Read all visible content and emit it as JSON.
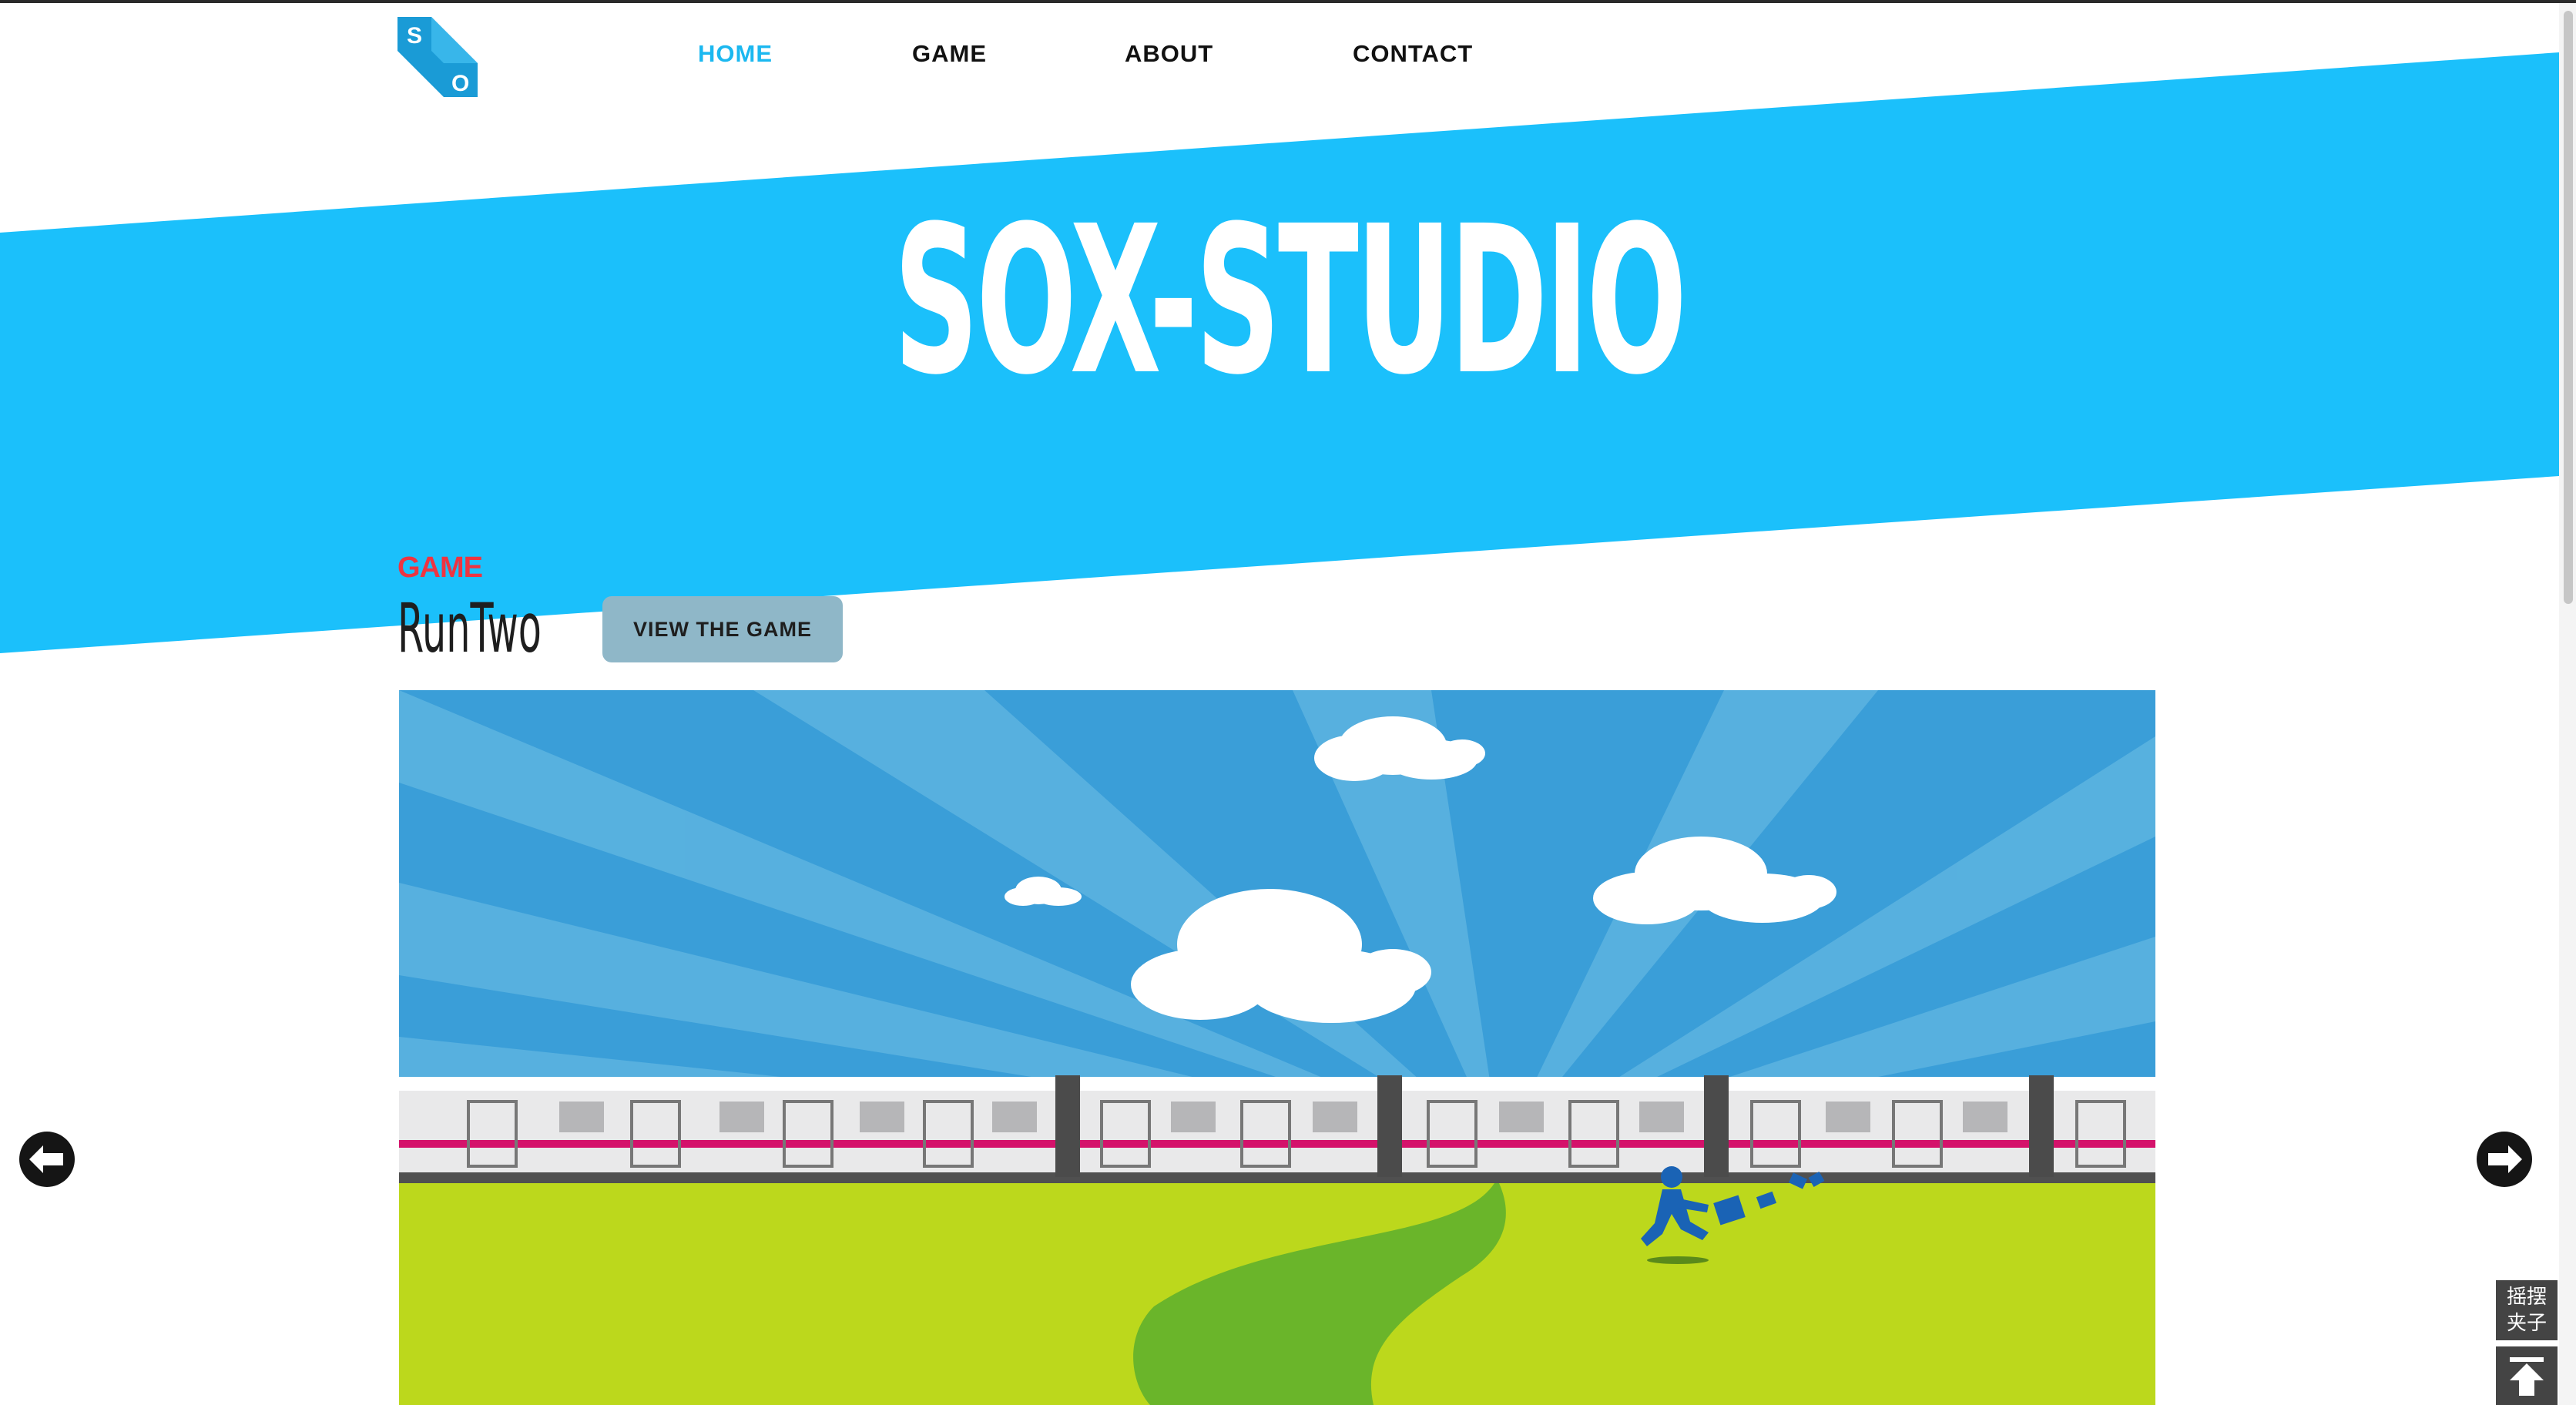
{
  "nav": {
    "logo_letters": [
      "S",
      "O"
    ],
    "items": [
      {
        "label": "HOME",
        "active": true
      },
      {
        "label": "GAME",
        "active": false
      },
      {
        "label": "ABOUT",
        "active": false
      },
      {
        "label": "CONTACT",
        "active": false
      }
    ]
  },
  "hero": {
    "title": "SOX-STUDIO"
  },
  "feature": {
    "kicker": "GAME",
    "title": "RunTwo",
    "button_label": "VIEW THE GAME"
  },
  "carousel": {
    "prev_icon": "arrow-left-icon",
    "next_icon": "arrow-right-icon"
  },
  "floating_tools": {
    "label": "摇摆\n夹子",
    "top_icon": "arrow-up-to-top-icon"
  },
  "colors": {
    "brand_blue": "#1bc0fb",
    "accent_red": "#ee3441",
    "button_gray_blue": "#8fb7c8",
    "sky_blue": "#3a9ed8",
    "grass_green": "#bcd81c",
    "train_stripe": "#d4126b"
  }
}
